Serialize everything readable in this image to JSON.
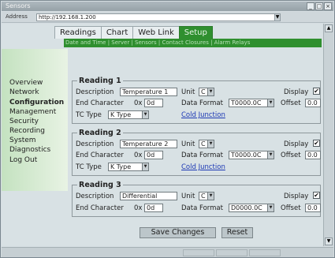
{
  "window": {
    "title": "Sensors"
  },
  "address": {
    "label": "Address",
    "value": "http://192.168.1.200"
  },
  "tabs": [
    "Readings",
    "Chart",
    "Web Link",
    "Setup"
  ],
  "subnav": "Date and Time | Server | Sensors | Contact Closures | Alarm Relays",
  "sidebar": [
    "Overview",
    "Network",
    "Configuration",
    "Management",
    "Security",
    "Recording",
    "System",
    "Diagnostics",
    "Log Out"
  ],
  "labels": {
    "description": "Description",
    "unit": "Unit",
    "display": "Display",
    "end_char": "End Character",
    "hex_prefix": "0x",
    "data_format": "Data Format",
    "offset": "Offset",
    "tc_type": "TC Type"
  },
  "readings": [
    {
      "title": "Reading 1",
      "description": "Temperature 1",
      "unit": "C",
      "display_checked": "✔",
      "end_char": "0d",
      "data_format": "T0000.0C",
      "offset": "0.0",
      "tc_type": "K Type",
      "cold_junction": "Cold Junction"
    },
    {
      "title": "Reading 2",
      "description": "Temperature 2",
      "unit": "C",
      "display_checked": "✔",
      "end_char": "0d",
      "data_format": "T0000.0C",
      "offset": "0.0",
      "tc_type": "K Type",
      "cold_junction": "Cold Junction"
    },
    {
      "title": "Reading 3",
      "description": "Differential",
      "unit": "C",
      "display_checked": "✔",
      "end_char": "0d",
      "data_format": "D0000.0C",
      "offset": "0.0"
    }
  ],
  "buttons": {
    "save": "Save Changes",
    "reset": "Reset"
  },
  "icons": {
    "minimize": "minimize-icon",
    "maximize": "maximize-icon",
    "close": "close-icon",
    "dropdown": "chevron-down-icon"
  },
  "colors": {
    "accent": "#2f8f2f",
    "link": "#1c38b4"
  }
}
